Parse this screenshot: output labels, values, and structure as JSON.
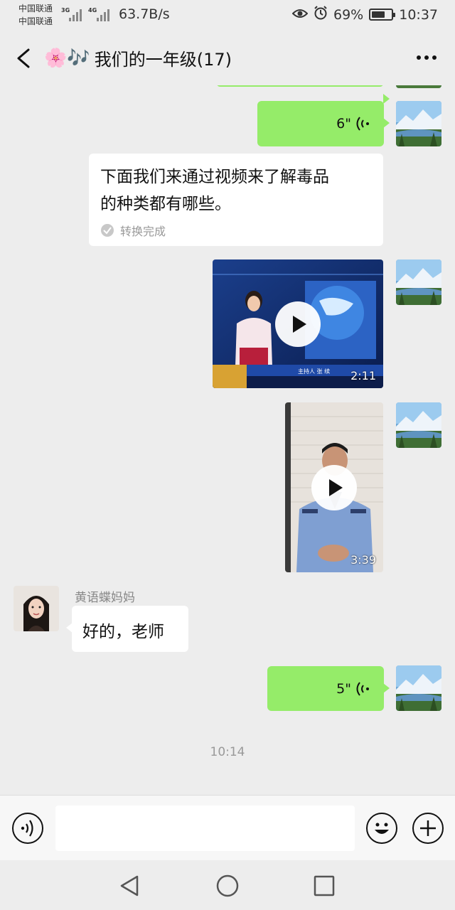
{
  "status_bar": {
    "carrier_1": "中国联通",
    "carrier_2": "中国联通",
    "net_1": "3G",
    "net_2": "4G",
    "speed": "63.7B/s",
    "battery": "69%",
    "battery_level": 0.69,
    "time": "10:37"
  },
  "header": {
    "title_emoji": "🌸🎶",
    "title": "我们的一年级(17)"
  },
  "messages": [
    {
      "type": "voice",
      "side": "right",
      "duration": "6\""
    },
    {
      "type": "text",
      "side": "left",
      "text_line1": "下面我们来通过视频来了解毒品",
      "text_line2": "的种类都有哪些。",
      "status": "转换完成"
    },
    {
      "type": "video",
      "side": "right",
      "duration": "2:11",
      "overlay_text": "主持人  张 续"
    },
    {
      "type": "video",
      "side": "right",
      "duration": "3:39"
    },
    {
      "type": "text",
      "side": "left",
      "sender": "黄语蝶妈妈",
      "text": "好的，老师"
    },
    {
      "type": "voice",
      "side": "right",
      "duration": "5\""
    }
  ],
  "timestamp": "10:14",
  "input": {
    "placeholder": ""
  },
  "colors": {
    "bubble_green": "#95ec69",
    "background": "#ededed",
    "bubble_white": "#ffffff"
  },
  "icons": {
    "back": "chevron-left-icon",
    "more": "more-dots-icon",
    "voice": "voice-wave-icon",
    "emoji": "smiley-icon",
    "plus": "plus-icon",
    "nav_back": "triangle-back-icon",
    "nav_home": "circle-home-icon",
    "nav_recent": "square-recent-icon"
  }
}
